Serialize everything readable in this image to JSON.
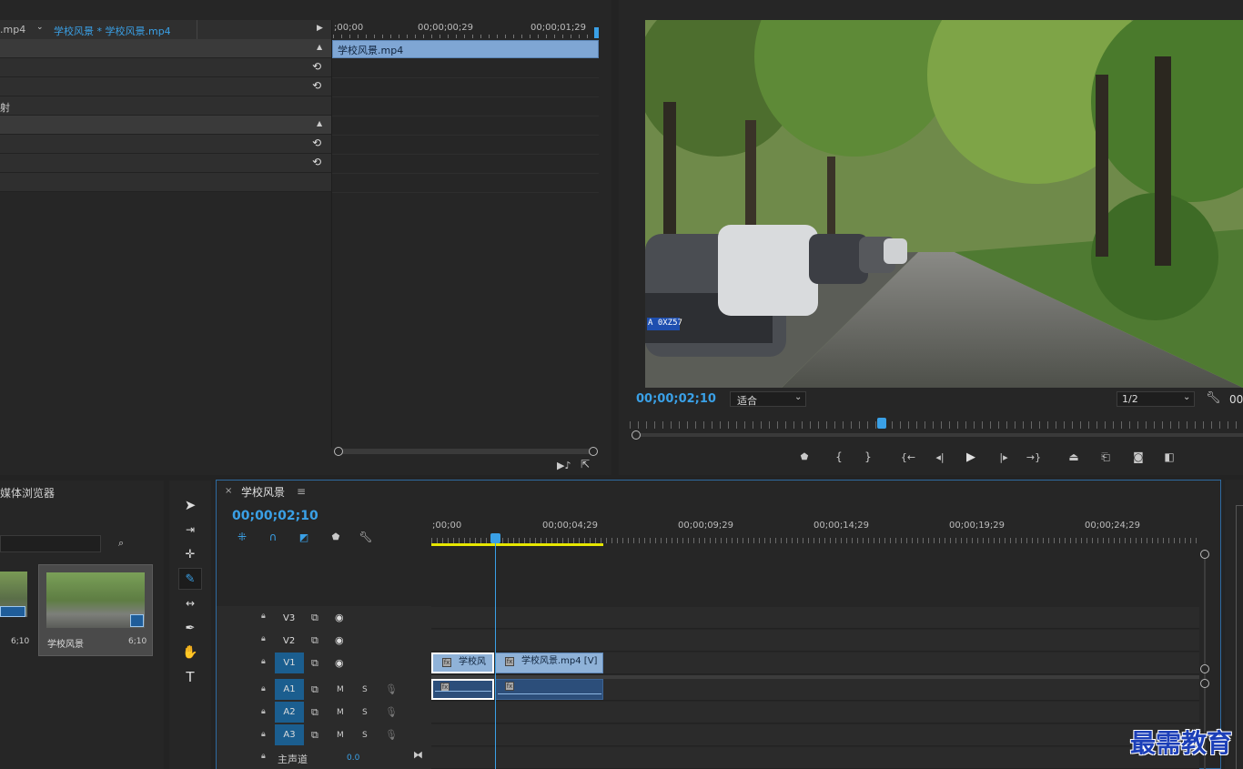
{
  "effect_controls": {
    "source_tab": ".mp4",
    "clip_tab": "学校风景 * 学校风景.mp4",
    "partial_label": "射",
    "timecodes": [
      ";00;00",
      "00;00;00;29",
      "00;00;01;29"
    ],
    "clip_label": "学校风景.mp4"
  },
  "program_monitor": {
    "timecode": "00;00;02;10",
    "zoom": "适合",
    "resolution": "1/2",
    "duration_partial": "00",
    "plate_text": "A 0XZ57",
    "controls": [
      "marker-in-icon",
      "mark-in-icon",
      "mark-out-icon",
      "go-to-in-icon",
      "step-back-icon",
      "play-icon",
      "step-forward-icon",
      "go-to-out-icon",
      "lift-icon",
      "extract-icon",
      "camera-icon",
      "compare-icon"
    ]
  },
  "project": {
    "tab_label": "媒体浏览器",
    "items": [
      {
        "name": "",
        "duration": "6;10"
      },
      {
        "name": "学校风景",
        "duration": "6;10"
      }
    ]
  },
  "timeline": {
    "tab_title": "学校风景",
    "timecode": "00;00;02;10",
    "ruler": [
      ";00;00",
      "00;00;04;29",
      "00;00;09;29",
      "00;00;14;29",
      "00;00;19;29",
      "00;00;24;29"
    ],
    "video_tracks": [
      "V3",
      "V2",
      "V1"
    ],
    "audio_tracks": [
      "A1",
      "A2",
      "A3"
    ],
    "mute_label": "M",
    "solo_label": "S",
    "master_label": "主声道",
    "master_value": "0.0",
    "clip_v1_a": "学校风",
    "clip_v1_b": "学校风景.mp4 [V]",
    "fx_label": "fx"
  },
  "watermark": "最需教育",
  "colors": {
    "accent": "#3aa0e6",
    "clip_video": "#8fb2d8",
    "clip_audio": "#2c4e7a",
    "work_area": "#e6e600",
    "track_target": "#1b5e8f"
  }
}
